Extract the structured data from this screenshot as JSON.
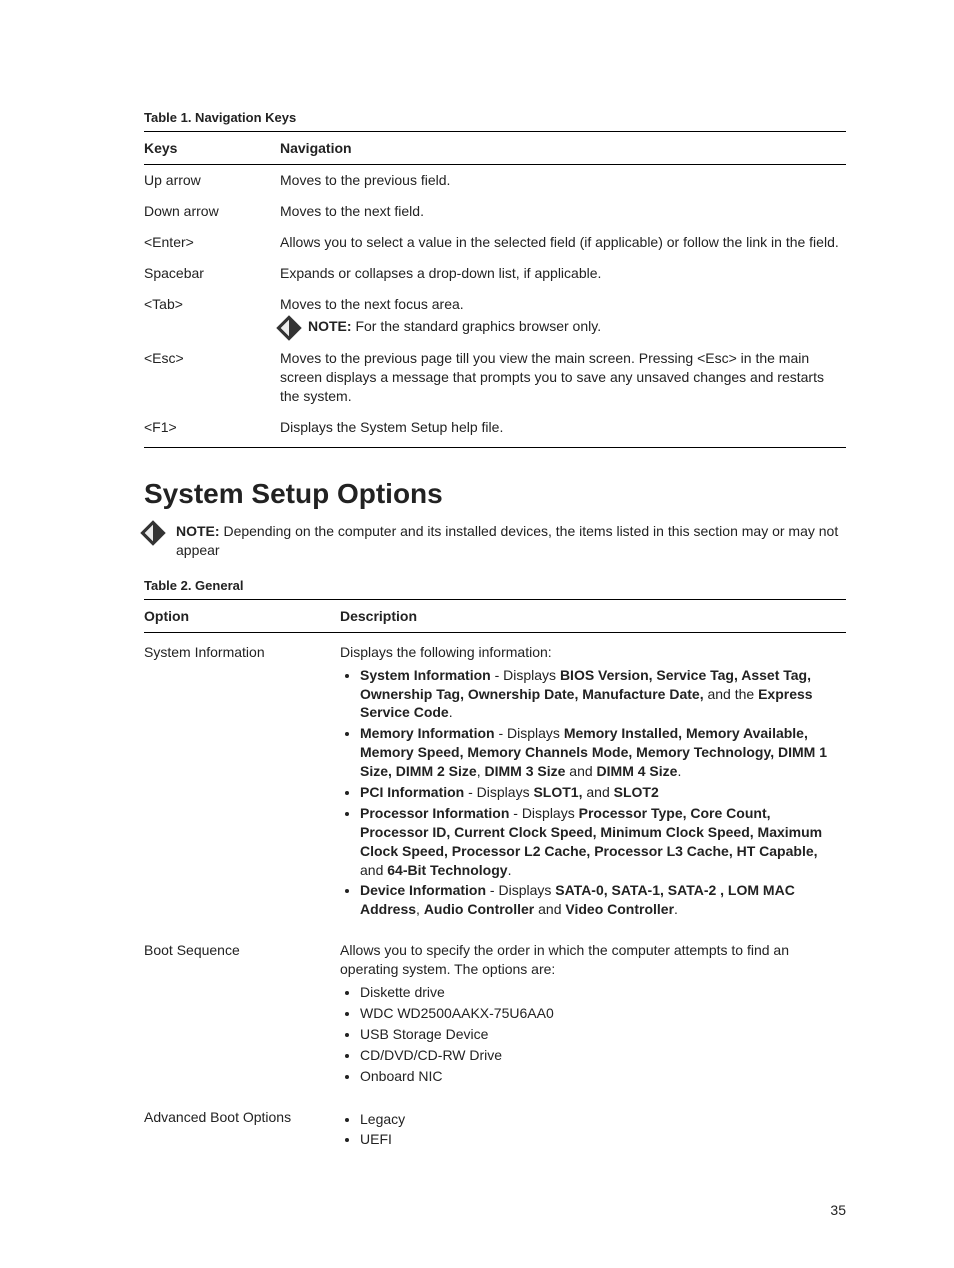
{
  "table1": {
    "caption": "Table 1. Navigation Keys",
    "headers": [
      "Keys",
      "Navigation"
    ],
    "rows": {
      "up": {
        "key": "Up arrow",
        "nav": "Moves to the previous field."
      },
      "down": {
        "key": "Down arrow",
        "nav": "Moves to the next field."
      },
      "enter": {
        "key": "<Enter>",
        "nav": "Allows you to select a value in the selected field (if applicable) or follow the link in the field."
      },
      "space": {
        "key": "Spacebar",
        "nav": "Expands or collapses a drop-down list, if applicable."
      },
      "tab": {
        "key": "<Tab>",
        "nav": "Moves to the next focus area.",
        "note_label": "NOTE: ",
        "note_text": "For the standard graphics browser only."
      },
      "esc": {
        "key": "<Esc>",
        "nav": "Moves to the previous page till you view the main screen. Pressing <Esc> in the main screen displays a message that prompts you to save any unsaved changes and restarts the system."
      },
      "f1": {
        "key": "<F1>",
        "nav": "Displays the System Setup help file."
      }
    }
  },
  "section_heading": "System Setup Options",
  "section_note": {
    "label": "NOTE: ",
    "text": "Depending on the computer and its installed devices, the items listed in this section may or may not appear"
  },
  "table2": {
    "caption": "Table 2. General",
    "headers": [
      "Option",
      "Description"
    ],
    "sysinfo": {
      "option": "System Information",
      "intro": "Displays the following information:",
      "b1": {
        "lead": "System Information",
        "mid": " - Displays ",
        "bold1": "BIOS Version, Service Tag, Asset Tag, Ownership Tag, Ownership Date, Manufacture Date,",
        "mid2": " and the ",
        "bold2": "Express Service Code",
        "tail": "."
      },
      "b2": {
        "lead": "Memory Information",
        "mid": " - Displays ",
        "bold1": "Memory Installed, Memory Available, Memory Speed, Memory Channels Mode, Memory Technology, DIMM 1 Size, DIMM 2 Size",
        "mid2": ", ",
        "bold2": "DIMM 3 Size",
        "mid3": " and ",
        "bold3": "DIMM 4 Size",
        "tail": "."
      },
      "b3": {
        "lead": "PCI Information",
        "mid": " - Displays ",
        "bold1": "SLOT1,",
        "mid2": " and ",
        "bold2": "SLOT2"
      },
      "b4": {
        "lead": "Processor Information",
        "mid": " - Displays ",
        "bold1": "Processor Type, Core Count, Processor ID, Current Clock Speed, Minimum Clock Speed, Maximum Clock Speed, Processor L2 Cache, Processor L3 Cache, HT Capable,",
        "mid2": " and ",
        "bold2": "64-Bit Technology",
        "tail": "."
      },
      "b5": {
        "lead": "Device Information",
        "mid": " - Displays ",
        "bold1": "SATA-0, SATA-1, SATA-2 , LOM MAC Address",
        "mid2": ", ",
        "bold2": "Audio Controller",
        "mid3": " and ",
        "bold3": "Video Controller",
        "tail": "."
      }
    },
    "boot": {
      "option": "Boot Sequence",
      "intro": "Allows you to specify the order in which the computer attempts to find an operating system. The options are:",
      "items": [
        "Diskette drive",
        "WDC WD2500AAKX-75U6AA0",
        "USB Storage Device",
        "CD/DVD/CD-RW Drive",
        "Onboard NIC"
      ]
    },
    "adv": {
      "option": "Advanced Boot Options",
      "items": [
        "Legacy",
        "UEFI"
      ]
    }
  },
  "page_number": "35"
}
